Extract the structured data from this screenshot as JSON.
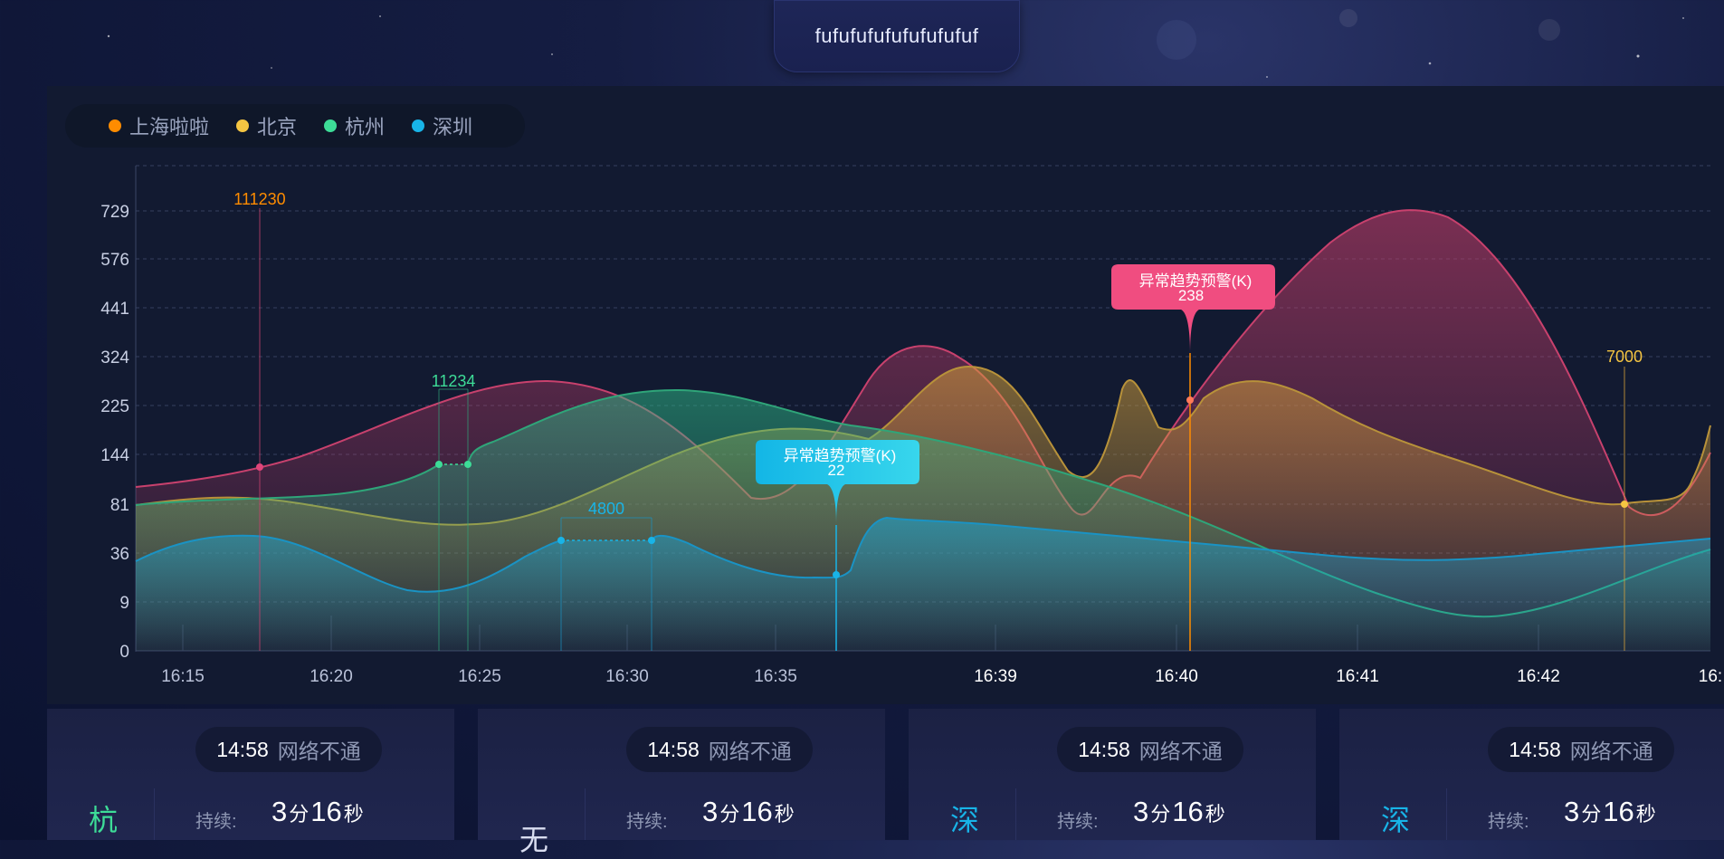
{
  "header": {
    "title": "fufufufufufufufufuf"
  },
  "legend": [
    {
      "label": "上海啦啦",
      "color": "#ff8c00"
    },
    {
      "label": "北京",
      "color": "#f5c542"
    },
    {
      "label": "杭州",
      "color": "#3ddc97"
    },
    {
      "label": "深圳",
      "color": "#18b4e8"
    }
  ],
  "chart_data": {
    "type": "area",
    "x_ticks": [
      "16:15",
      "16:20",
      "16:25",
      "16:30",
      "16:35",
      "16:39",
      "16:40",
      "16:41",
      "16:42",
      "16:"
    ],
    "y_ticks": [
      "0",
      "9",
      "36",
      "81",
      "144",
      "225",
      "324",
      "441",
      "576",
      "729"
    ],
    "grid": true,
    "annotations": [
      {
        "label": "111230",
        "color": "#ff8c00"
      },
      {
        "label": "11234",
        "color": "#3ddc97"
      },
      {
        "label": "4800",
        "color": "#18b4e8"
      },
      {
        "label": "7000",
        "color": "#f5c542"
      }
    ],
    "alerts": [
      {
        "title": "异常趋势预警(K)",
        "value": "22",
        "color": "#18b4e8"
      },
      {
        "title": "异常趋势预警(K)",
        "value": "238",
        "color": "#f24a7f"
      }
    ]
  },
  "cards": [
    {
      "time": "14:58",
      "status": "网络不通",
      "city": "杭",
      "city_color": "#3ddc97",
      "label": "持续:",
      "min": "3",
      "min_unit": "分",
      "sec": "16",
      "sec_unit": "秒"
    },
    {
      "time": "14:58",
      "status": "网络不通",
      "city": "无",
      "city_color": "#d8dcef",
      "label": "持续:",
      "min": "3",
      "min_unit": "分",
      "sec": "16",
      "sec_unit": "秒"
    },
    {
      "time": "14:58",
      "status": "网络不通",
      "city": "深",
      "city_color": "#18b4e8",
      "label": "持续:",
      "min": "3",
      "min_unit": "分",
      "sec": "16",
      "sec_unit": "秒"
    },
    {
      "time": "14:58",
      "status": "网络不通",
      "city": "深",
      "city_color": "#18b4e8",
      "label": "持续:",
      "min": "3",
      "min_unit": "分",
      "sec": "16",
      "sec_unit": "秒"
    }
  ]
}
